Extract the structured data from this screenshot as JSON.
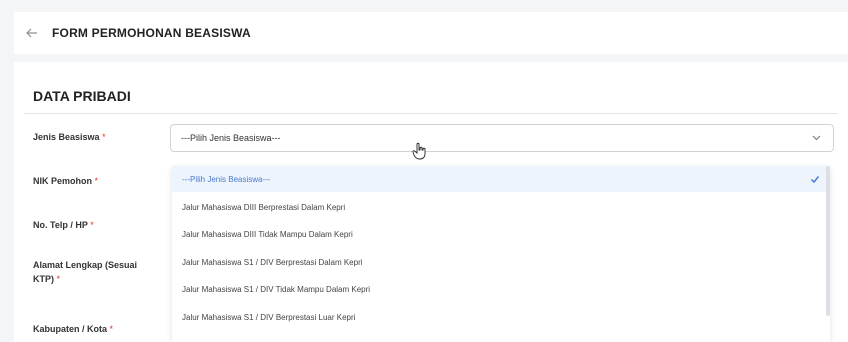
{
  "header": {
    "title": "FORM PERMOHONAN BEASISWA"
  },
  "section": {
    "title": "DATA PRIBADI"
  },
  "fields": {
    "jenis_beasiswa": "Jenis Beasiswa",
    "nik": "NIK Pemohon",
    "telp": "No. Telp / HP",
    "alamat_line1": "Alamat Lengkap (Sesuai",
    "alamat_line2": "KTP)",
    "kabupaten": "Kabupaten / Kota",
    "required_mark": "*"
  },
  "select": {
    "value": "---Pilih Jenis Beasiswa---"
  },
  "dropdown": {
    "items": [
      "---Pilih Jenis Beasiswa---",
      "Jalur Mahasiswa DIII Berprestasi Dalam Kepri",
      "Jalur Mahasiswa DIII Tidak Mampu Dalam Kepri",
      "Jalur Mahasiswa S1 / DIV Berprestasi Dalam Kepri",
      "Jalur Mahasiswa S1 / DIV Tidak Mampu Dalam Kepri",
      "Jalur Mahasiswa S1 / DIV Berprestasi Luar Kepri"
    ],
    "selected_index": 0
  },
  "colors": {
    "accent": "#4a7bd0",
    "required": "#e3342f"
  }
}
